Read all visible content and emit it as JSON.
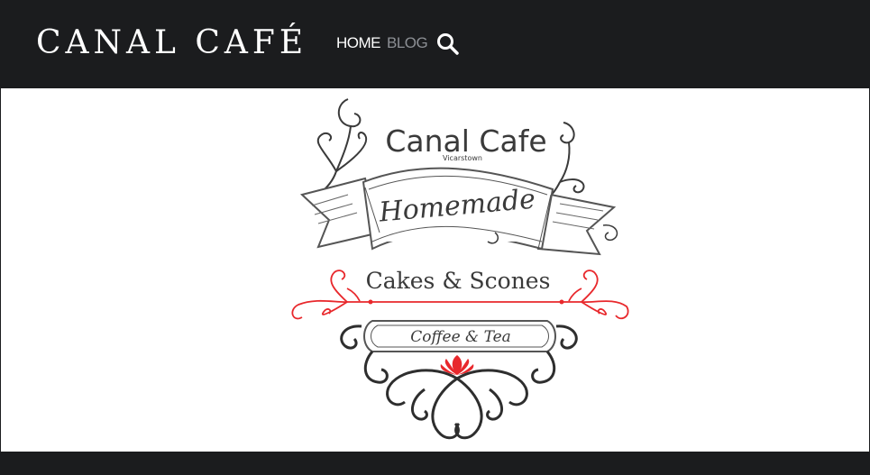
{
  "header": {
    "site_title": "CANAL CAFÉ",
    "nav": [
      {
        "label": "HOME",
        "active": true
      },
      {
        "label": "BLOG",
        "active": false
      }
    ],
    "search_icon": "search-icon"
  },
  "logo": {
    "name": "Canal Cafe",
    "location": "Vicarstown",
    "banner": "Homemade",
    "tagline": "Cakes & Scones",
    "plaque": "Coffee & Tea"
  },
  "colors": {
    "header_bg": "#1b1c1e",
    "nav_active": "#ffffff",
    "nav_inactive": "#8c8f94",
    "logo_ink": "#3a3a3a",
    "logo_accent": "#e8282c"
  }
}
